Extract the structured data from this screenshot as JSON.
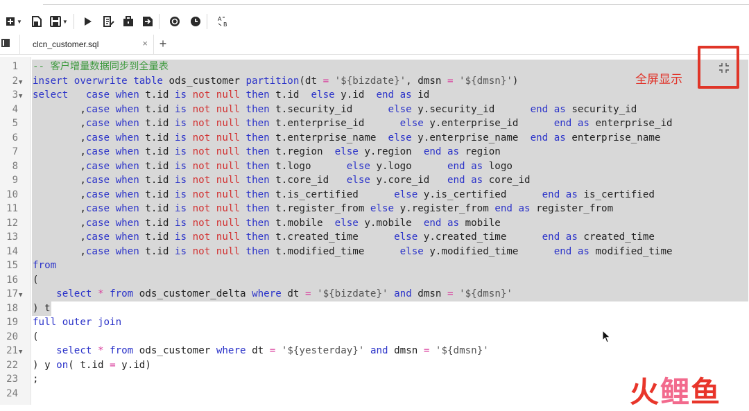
{
  "tab": {
    "file_name": "clcn_customer.sql",
    "close_glyph": "×",
    "add_glyph": "+"
  },
  "annotation": {
    "fullscreen_label": "全屏显示"
  },
  "watermark": {
    "chars": [
      "火",
      "鲤",
      "鱼"
    ]
  },
  "editor": {
    "lines": [
      {
        "n": "1",
        "fold": false,
        "tokens": [
          [
            "cm",
            "-- 客户增量数据同步到全量表"
          ]
        ]
      },
      {
        "n": "2",
        "fold": true,
        "tokens": [
          [
            "kw",
            "insert overwrite table"
          ],
          [
            "t",
            " ods_customer "
          ],
          [
            "kw",
            "partition"
          ],
          [
            "t",
            "(dt "
          ],
          [
            "op",
            "="
          ],
          [
            "t",
            " "
          ],
          [
            "str",
            "'${bizdate}'"
          ],
          [
            "t",
            ", dmsn "
          ],
          [
            "op",
            "="
          ],
          [
            "t",
            " "
          ],
          [
            "str",
            "'${dmsn}'"
          ],
          [
            "t",
            ")"
          ]
        ]
      },
      {
        "n": "3",
        "fold": true,
        "tokens": [
          [
            "kw",
            "select"
          ],
          [
            "t",
            "   "
          ],
          [
            "kw",
            "case when"
          ],
          [
            "t",
            " t.id "
          ],
          [
            "kw",
            "is"
          ],
          [
            "t",
            " "
          ],
          [
            "nl",
            "not null"
          ],
          [
            "t",
            " "
          ],
          [
            "kw",
            "then"
          ],
          [
            "t",
            " t.id  "
          ],
          [
            "kw",
            "else"
          ],
          [
            "t",
            " y.id  "
          ],
          [
            "kw",
            "end as"
          ],
          [
            "t",
            " id"
          ]
        ]
      },
      {
        "n": "4",
        "fold": false,
        "tokens": [
          [
            "t",
            "        ,"
          ],
          [
            "kw",
            "case when"
          ],
          [
            "t",
            " t.id "
          ],
          [
            "kw",
            "is"
          ],
          [
            "t",
            " "
          ],
          [
            "nl",
            "not null"
          ],
          [
            "t",
            " "
          ],
          [
            "kw",
            "then"
          ],
          [
            "t",
            " t.security_id      "
          ],
          [
            "kw",
            "else"
          ],
          [
            "t",
            " y.security_id      "
          ],
          [
            "kw",
            "end as"
          ],
          [
            "t",
            " security_id"
          ]
        ]
      },
      {
        "n": "5",
        "fold": false,
        "tokens": [
          [
            "t",
            "        ,"
          ],
          [
            "kw",
            "case when"
          ],
          [
            "t",
            " t.id "
          ],
          [
            "kw",
            "is"
          ],
          [
            "t",
            " "
          ],
          [
            "nl",
            "not null"
          ],
          [
            "t",
            " "
          ],
          [
            "kw",
            "then"
          ],
          [
            "t",
            " t.enterprise_id      "
          ],
          [
            "kw",
            "else"
          ],
          [
            "t",
            " y.enterprise_id      "
          ],
          [
            "kw",
            "end as"
          ],
          [
            "t",
            " enterprise_id"
          ]
        ]
      },
      {
        "n": "6",
        "fold": false,
        "tokens": [
          [
            "t",
            "        ,"
          ],
          [
            "kw",
            "case when"
          ],
          [
            "t",
            " t.id "
          ],
          [
            "kw",
            "is"
          ],
          [
            "t",
            " "
          ],
          [
            "nl",
            "not null"
          ],
          [
            "t",
            " "
          ],
          [
            "kw",
            "then"
          ],
          [
            "t",
            " t.enterprise_name  "
          ],
          [
            "kw",
            "else"
          ],
          [
            "t",
            " y.enterprise_name  "
          ],
          [
            "kw",
            "end as"
          ],
          [
            "t",
            " enterprise_name"
          ]
        ]
      },
      {
        "n": "7",
        "fold": false,
        "tokens": [
          [
            "t",
            "        ,"
          ],
          [
            "kw",
            "case when"
          ],
          [
            "t",
            " t.id "
          ],
          [
            "kw",
            "is"
          ],
          [
            "t",
            " "
          ],
          [
            "nl",
            "not null"
          ],
          [
            "t",
            " "
          ],
          [
            "kw",
            "then"
          ],
          [
            "t",
            " t.region  "
          ],
          [
            "kw",
            "else"
          ],
          [
            "t",
            " y.region  "
          ],
          [
            "kw",
            "end as"
          ],
          [
            "t",
            " region"
          ]
        ]
      },
      {
        "n": "8",
        "fold": false,
        "tokens": [
          [
            "t",
            "        ,"
          ],
          [
            "kw",
            "case when"
          ],
          [
            "t",
            " t.id "
          ],
          [
            "kw",
            "is"
          ],
          [
            "t",
            " "
          ],
          [
            "nl",
            "not null"
          ],
          [
            "t",
            " "
          ],
          [
            "kw",
            "then"
          ],
          [
            "t",
            " t.logo      "
          ],
          [
            "kw",
            "else"
          ],
          [
            "t",
            " y.logo      "
          ],
          [
            "kw",
            "end as"
          ],
          [
            "t",
            " logo"
          ]
        ]
      },
      {
        "n": "9",
        "fold": false,
        "tokens": [
          [
            "t",
            "        ,"
          ],
          [
            "kw",
            "case when"
          ],
          [
            "t",
            " t.id "
          ],
          [
            "kw",
            "is"
          ],
          [
            "t",
            " "
          ],
          [
            "nl",
            "not null"
          ],
          [
            "t",
            " "
          ],
          [
            "kw",
            "then"
          ],
          [
            "t",
            " t.core_id   "
          ],
          [
            "kw",
            "else"
          ],
          [
            "t",
            " y.core_id   "
          ],
          [
            "kw",
            "end as"
          ],
          [
            "t",
            " core_id"
          ]
        ]
      },
      {
        "n": "10",
        "fold": false,
        "tokens": [
          [
            "t",
            "        ,"
          ],
          [
            "kw",
            "case when"
          ],
          [
            "t",
            " t.id "
          ],
          [
            "kw",
            "is"
          ],
          [
            "t",
            " "
          ],
          [
            "nl",
            "not null"
          ],
          [
            "t",
            " "
          ],
          [
            "kw",
            "then"
          ],
          [
            "t",
            " t.is_certified      "
          ],
          [
            "kw",
            "else"
          ],
          [
            "t",
            " y.is_certified      "
          ],
          [
            "kw",
            "end as"
          ],
          [
            "t",
            " is_certified"
          ]
        ]
      },
      {
        "n": "11",
        "fold": false,
        "tokens": [
          [
            "t",
            "        ,"
          ],
          [
            "kw",
            "case when"
          ],
          [
            "t",
            " t.id "
          ],
          [
            "kw",
            "is"
          ],
          [
            "t",
            " "
          ],
          [
            "nl",
            "not null"
          ],
          [
            "t",
            " "
          ],
          [
            "kw",
            "then"
          ],
          [
            "t",
            " t.register_from "
          ],
          [
            "kw",
            "else"
          ],
          [
            "t",
            " y.register_from "
          ],
          [
            "kw",
            "end as"
          ],
          [
            "t",
            " register_from"
          ]
        ]
      },
      {
        "n": "12",
        "fold": false,
        "tokens": [
          [
            "t",
            "        ,"
          ],
          [
            "kw",
            "case when"
          ],
          [
            "t",
            " t.id "
          ],
          [
            "kw",
            "is"
          ],
          [
            "t",
            " "
          ],
          [
            "nl",
            "not null"
          ],
          [
            "t",
            " "
          ],
          [
            "kw",
            "then"
          ],
          [
            "t",
            " t.mobile  "
          ],
          [
            "kw",
            "else"
          ],
          [
            "t",
            " y.mobile  "
          ],
          [
            "kw",
            "end as"
          ],
          [
            "t",
            " mobile"
          ]
        ]
      },
      {
        "n": "13",
        "fold": false,
        "tokens": [
          [
            "t",
            "        ,"
          ],
          [
            "kw",
            "case when"
          ],
          [
            "t",
            " t.id "
          ],
          [
            "kw",
            "is"
          ],
          [
            "t",
            " "
          ],
          [
            "nl",
            "not null"
          ],
          [
            "t",
            " "
          ],
          [
            "kw",
            "then"
          ],
          [
            "t",
            " t.created_time      "
          ],
          [
            "kw",
            "else"
          ],
          [
            "t",
            " y.created_time      "
          ],
          [
            "kw",
            "end as"
          ],
          [
            "t",
            " created_time"
          ]
        ]
      },
      {
        "n": "14",
        "fold": false,
        "tokens": [
          [
            "t",
            "        ,"
          ],
          [
            "kw",
            "case when"
          ],
          [
            "t",
            " t.id "
          ],
          [
            "kw",
            "is"
          ],
          [
            "t",
            " "
          ],
          [
            "nl",
            "not null"
          ],
          [
            "t",
            " "
          ],
          [
            "kw",
            "then"
          ],
          [
            "t",
            " t.modified_time      "
          ],
          [
            "kw",
            "else"
          ],
          [
            "t",
            " y.modified_time      "
          ],
          [
            "kw",
            "end as"
          ],
          [
            "t",
            " modified_time"
          ]
        ]
      },
      {
        "n": "15",
        "fold": false,
        "tokens": [
          [
            "kw",
            "from"
          ]
        ]
      },
      {
        "n": "16",
        "fold": false,
        "tokens": [
          [
            "t",
            "("
          ]
        ]
      },
      {
        "n": "17",
        "fold": true,
        "tokens": [
          [
            "t",
            "    "
          ],
          [
            "kw",
            "select"
          ],
          [
            "t",
            " "
          ],
          [
            "op",
            "*"
          ],
          [
            "t",
            " "
          ],
          [
            "kw",
            "from"
          ],
          [
            "t",
            " ods_customer_delta "
          ],
          [
            "kw",
            "where"
          ],
          [
            "t",
            " dt "
          ],
          [
            "op",
            "="
          ],
          [
            "t",
            " "
          ],
          [
            "str",
            "'${bizdate}'"
          ],
          [
            "t",
            " "
          ],
          [
            "kw",
            "and"
          ],
          [
            "t",
            " dmsn "
          ],
          [
            "op",
            "="
          ],
          [
            "t",
            " "
          ],
          [
            "str",
            "'${dmsn}'"
          ]
        ]
      },
      {
        "n": "18",
        "fold": false,
        "tokens": [
          [
            "t",
            ") t"
          ]
        ]
      },
      {
        "n": "19",
        "fold": false,
        "tokens": [
          [
            "kw",
            "full outer join"
          ]
        ]
      },
      {
        "n": "20",
        "fold": false,
        "tokens": [
          [
            "t",
            "("
          ]
        ]
      },
      {
        "n": "21",
        "fold": true,
        "tokens": [
          [
            "t",
            "    "
          ],
          [
            "kw",
            "select"
          ],
          [
            "t",
            " "
          ],
          [
            "op",
            "*"
          ],
          [
            "t",
            " "
          ],
          [
            "kw",
            "from"
          ],
          [
            "t",
            " ods_customer "
          ],
          [
            "kw",
            "where"
          ],
          [
            "t",
            " dt "
          ],
          [
            "op",
            "="
          ],
          [
            "t",
            " "
          ],
          [
            "str",
            "'${yesterday}'"
          ],
          [
            "t",
            " "
          ],
          [
            "kw",
            "and"
          ],
          [
            "t",
            " dmsn "
          ],
          [
            "op",
            "="
          ],
          [
            "t",
            " "
          ],
          [
            "str",
            "'${dmsn}'"
          ]
        ]
      },
      {
        "n": "22",
        "fold": false,
        "tokens": [
          [
            "t",
            ") y "
          ],
          [
            "kw",
            "on"
          ],
          [
            "t",
            "( t.id "
          ],
          [
            "op",
            "="
          ],
          [
            "t",
            " y.id)"
          ]
        ]
      },
      {
        "n": "23",
        "fold": false,
        "tokens": [
          [
            "t",
            ";"
          ]
        ]
      },
      {
        "n": "24",
        "fold": false,
        "tokens": []
      }
    ]
  },
  "colors": {
    "keyword": "#2b33c9",
    "null": "#d23232",
    "string": "#555555",
    "operator": "#d93b9b",
    "comment": "#3f9a3f",
    "selection": "#d8d8d8",
    "highlight_box": "#e03528"
  }
}
